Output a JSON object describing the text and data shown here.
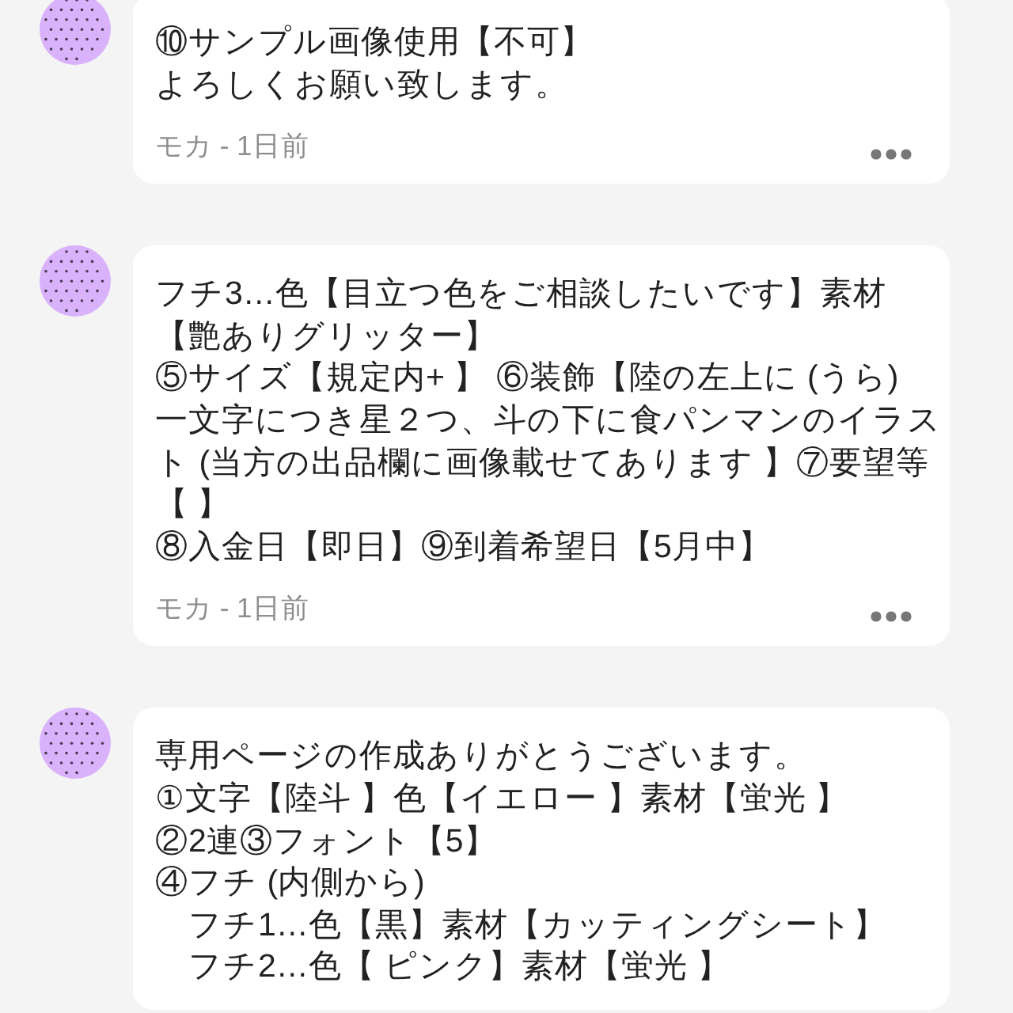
{
  "comments": [
    {
      "lines": [
        "⑩サンプル画像使用【不可】",
        "よろしくお願い致します。"
      ],
      "meta": "モカ - 1日前"
    },
    {
      "lines": [
        "フチ3…色【目立つ色をご相談したいです】素材",
        "【艶ありグリッター】",
        "⑤サイズ【規定内+ 】 ⑥装飾【陸の左上に (うら)",
        "一文字につき星２つ、斗の下に食パンマンのイラス",
        "ト (当方の出品欄に画像載せてあります 】⑦要望等",
        "【 】",
        "⑧入金日【即日】⑨到着希望日【5月中】"
      ],
      "meta": "モカ - 1日前"
    },
    {
      "lines": [
        "専用ページの作成ありがとうございます。",
        "①文字【陸斗 】色【イエロー 】素材【蛍光 】",
        "②2連③フォント【5】",
        "④フチ (内側から)",
        "　フチ1…色【黒】素材【カッティングシート】",
        "　フチ2…色【 ピンク】素材【蛍光 】"
      ]
    }
  ]
}
